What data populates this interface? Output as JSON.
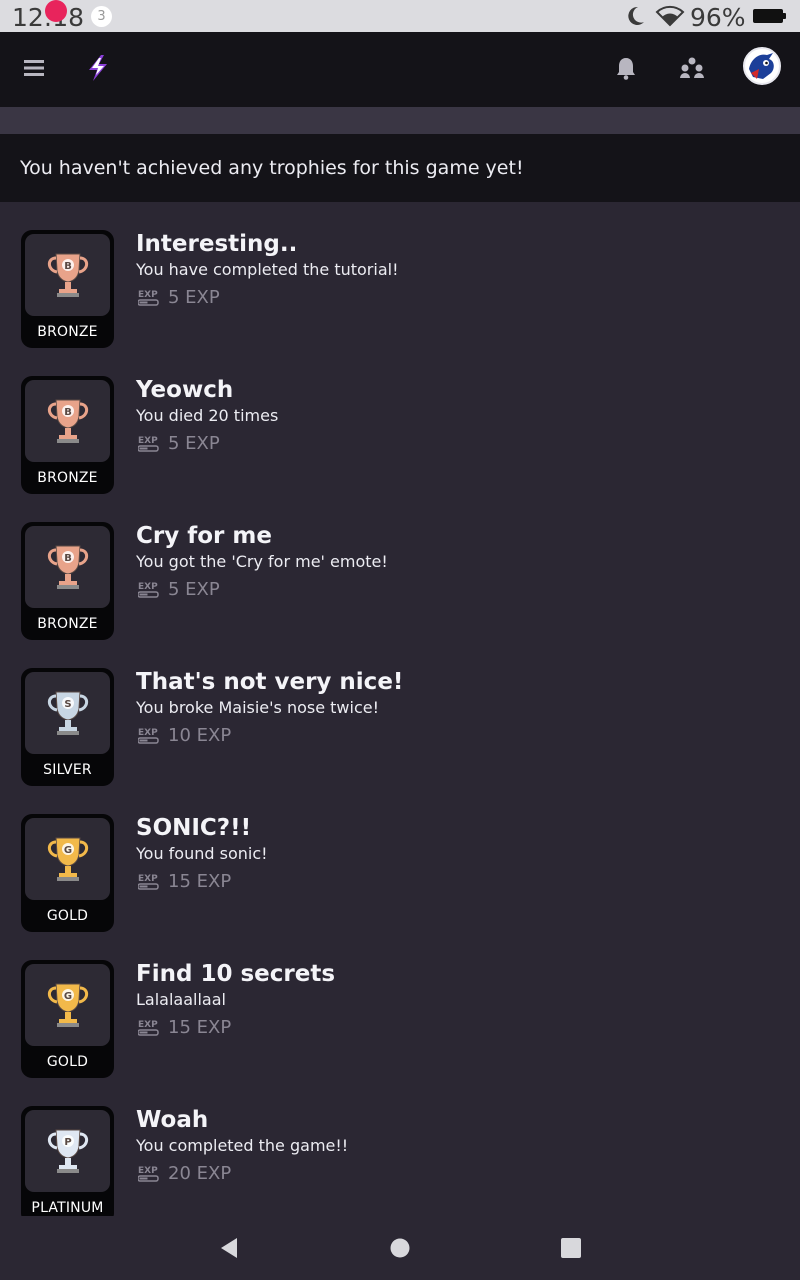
{
  "status_bar": {
    "time": "12:18",
    "notification_count": "3",
    "battery_percent": "96%"
  },
  "header": {
    "icons": [
      "menu-icon",
      "lightning-logo-icon",
      "bell-icon",
      "friends-icon",
      "avatar"
    ]
  },
  "banner": {
    "message": "You haven't achieved any trophies for this game yet!"
  },
  "trophies": [
    {
      "title": "Interesting..",
      "description": "You have completed the tutorial!",
      "exp": "5 EXP",
      "tier": "BRONZE"
    },
    {
      "title": "Yeowch",
      "description": "You died 20 times",
      "exp": "5 EXP",
      "tier": "BRONZE"
    },
    {
      "title": "Cry for me",
      "description": "You got the 'Cry for me' emote!",
      "exp": "5 EXP",
      "tier": "BRONZE"
    },
    {
      "title": "That's not very nice!",
      "description": "You broke Maisie's nose twice!",
      "exp": "10 EXP",
      "tier": "SILVER"
    },
    {
      "title": "SONIC?!!",
      "description": "You found sonic!",
      "exp": "15 EXP",
      "tier": "GOLD"
    },
    {
      "title": "Find 10 secrets",
      "description": "Lalalaallaal",
      "exp": "15 EXP",
      "tier": "GOLD"
    },
    {
      "title": "Woah",
      "description": "You completed the game!!",
      "exp": "20 EXP",
      "tier": "PLATINUM"
    }
  ],
  "trophy_badge_letters": {
    "BRONZE": "B",
    "SILVER": "S",
    "GOLD": "G",
    "PLATINUM": "P"
  },
  "colors": {
    "background": "#2b2733",
    "header": "#141318",
    "accent_notification": "#e8245c",
    "logo_purple": "#8b3fd9",
    "bronze": "#e8a38a",
    "silver": "#c8d6e3",
    "gold": "#f2b94a",
    "platinum": "#dfe7f2",
    "exp_text": "#8a8693"
  }
}
